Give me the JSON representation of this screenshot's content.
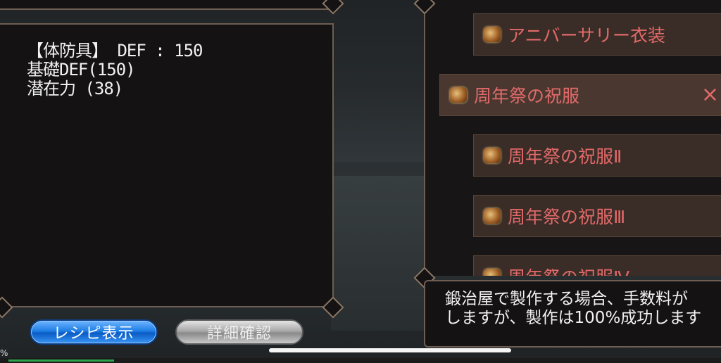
{
  "info": {
    "line1": "【体防具】 DEF : 150",
    "line2": "基礎DEF(150)",
    "line3": "潜在力 (38)"
  },
  "buttons": {
    "recipe_label": "レシピ表示",
    "detail_label": "詳細確認"
  },
  "list": {
    "items": [
      {
        "label": "アニバーサリー衣装",
        "selected": false
      },
      {
        "label": "周年祭の祝服",
        "selected": true
      },
      {
        "label": "周年祭の祝服Ⅱ",
        "selected": false
      },
      {
        "label": "周年祭の祝服Ⅲ",
        "selected": false
      },
      {
        "label": "周年祭の祝服Ⅳ",
        "selected": false
      }
    ],
    "close_glyph": "×"
  },
  "message": {
    "line1": "鍛治屋で製作する場合、手数料が",
    "line2": "しますが、製作は100%成功します"
  },
  "gauge": {
    "percent_label": "%",
    "fill_fraction": 0.15
  },
  "colors": {
    "item_text": "#e26a6a",
    "panel_border": "#6e5d52",
    "recipe_button": "#1f7fe6",
    "detail_button": "#a9a9a9"
  }
}
